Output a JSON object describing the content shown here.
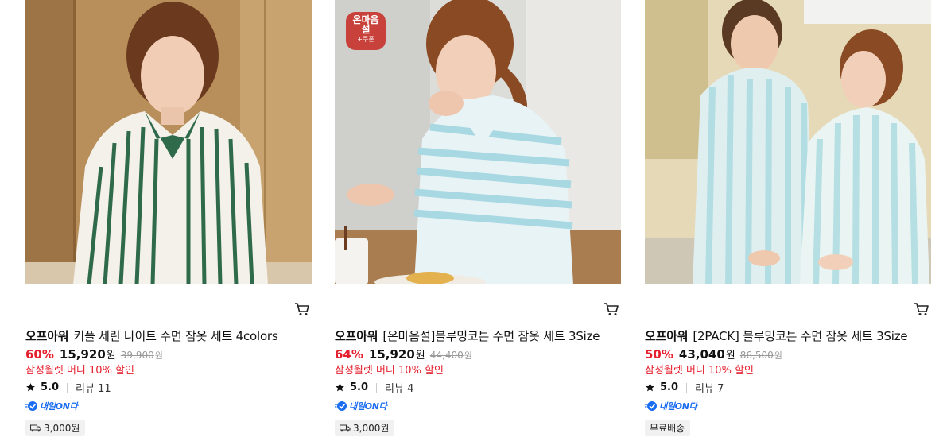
{
  "products": [
    {
      "brand": "오프아워",
      "name": "커플 세린 나이트 수면 잠옷 세트 4colors",
      "discount": "60%",
      "price": "15,920",
      "currency": "원",
      "original_price": "39,900",
      "promo": "삼성월렛 머니 10% 할인",
      "rating": "5.0",
      "reviews": "리뷰 11",
      "delivery_badge": "내일ON다",
      "shipping": "3,000원",
      "shipping_icon": "truck-icon"
    },
    {
      "brand": "오프아워",
      "name": "[온마음설]블루밍코튼 수면 잠옷 세트 3Size",
      "discount": "64%",
      "price": "15,920",
      "currency": "원",
      "original_price": "44,400",
      "promo": "삼성월렛 머니 10% 할인",
      "rating": "5.0",
      "reviews": "리뷰 4",
      "delivery_badge": "내일ON다",
      "shipping": "3,000원",
      "shipping_icon": "truck-icon",
      "coupon_badge": {
        "line1": "온마음",
        "line2": "설",
        "line3": "+쿠폰"
      }
    },
    {
      "brand": "오프아워",
      "name": "[2PACK] 블루밍코튼 수면 잠옷 세트 3Size",
      "discount": "50%",
      "price": "43,040",
      "currency": "원",
      "original_price": "86,500",
      "promo": "삼성월렛 머니 10% 할인",
      "rating": "5.0",
      "reviews": "리뷰 7",
      "delivery_badge": "내일ON다",
      "shipping": "무료배송"
    }
  ],
  "colors": {
    "accent_red": "#e5202e",
    "delivery_blue": "#1a6cf0",
    "coupon_red": "#c8413b"
  }
}
